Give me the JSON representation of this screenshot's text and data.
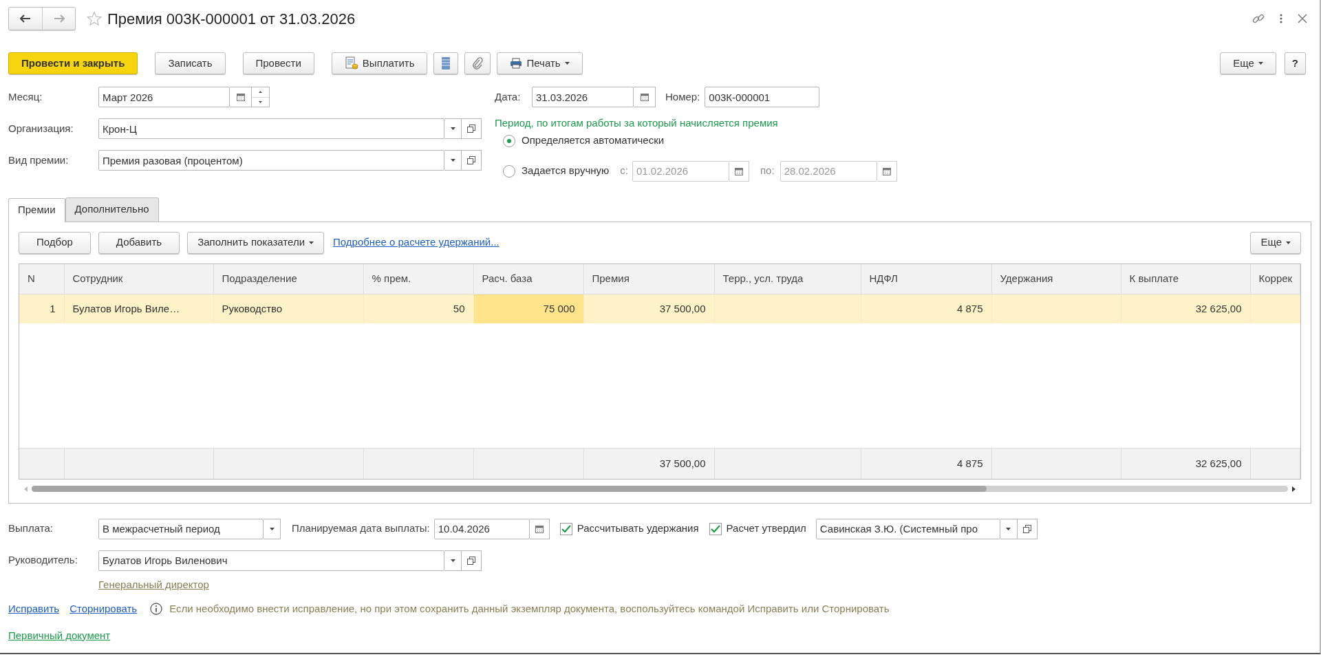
{
  "window": {
    "title": "Премия 003К-000001 от 31.03.2026",
    "favorite": false,
    "nav": [
      {
        "kind": "back",
        "disabled": false
      },
      {
        "kind": "forward",
        "disabled": true
      }
    ]
  },
  "toolbar": [
    {
      "label": "Провести и закрыть",
      "kind": "primary"
    },
    {
      "label": "Записать",
      "kind": "plain"
    },
    {
      "label": "Провести",
      "kind": "plain"
    },
    {
      "label": "Выплатить",
      "kind": "pay"
    },
    {
      "kind": "list"
    },
    {
      "kind": "clip"
    },
    {
      "label": "Печать",
      "kind": "print",
      "dropdown": true
    }
  ],
  "toolbar_right": [
    {
      "label": "Еще",
      "kind": "plain",
      "dropdown": true
    },
    {
      "label": "?",
      "kind": "help"
    }
  ],
  "fields_left": [
    {
      "label": "Месяц:",
      "value": "Март 2026",
      "kind": "month"
    },
    {
      "label": "Организация:",
      "value": "Крон-Ц",
      "kind": "ref"
    },
    {
      "label": "Вид премии:",
      "value": "Премия разовая (процентом)",
      "kind": "ref"
    }
  ],
  "date": {
    "label": "Дата:",
    "value": "31.03.2026"
  },
  "number": {
    "label": "Номер:",
    "value": "003К-000001"
  },
  "period": {
    "heading": "Период, по итогам работы за который начисляется премия",
    "options": [
      {
        "label": "Определяется автоматически",
        "selected": true
      },
      {
        "label": "Задается вручную",
        "selected": false
      }
    ],
    "from": {
      "label": "с:",
      "value": "01.02.2026",
      "disabled": true
    },
    "to": {
      "label": "по:",
      "value": "28.02.2026",
      "disabled": true
    }
  },
  "tabs": [
    {
      "label": "Премии",
      "selected": true
    },
    {
      "label": "Дополнительно",
      "selected": false
    }
  ],
  "table_toolbar": {
    "buttons": [
      {
        "label": "Подбор"
      },
      {
        "label": "Добавить"
      },
      {
        "label": "Заполнить показатели",
        "dropdown": true
      }
    ],
    "link": "Подробнее о расчете удержаний...",
    "more": {
      "label": "Еще",
      "dropdown": true
    }
  },
  "table": {
    "columns": [
      {
        "label": "N",
        "kind": "numeric"
      },
      {
        "label": "Сотрудник",
        "kind": "text"
      },
      {
        "label": "Подразделение",
        "kind": "text"
      },
      {
        "label": "% прем.",
        "kind": "numeric"
      },
      {
        "label": "Расч. база",
        "kind": "numeric"
      },
      {
        "label": "Премия",
        "kind": "numeric",
        "total": "37 500,00"
      },
      {
        "label": "Терр., усл. труда",
        "kind": "text"
      },
      {
        "label": "НДФЛ",
        "kind": "numeric",
        "total": "4 875"
      },
      {
        "label": "Удержания",
        "kind": "numeric"
      },
      {
        "label": "К выплате",
        "kind": "numeric",
        "total": "32 625,00"
      },
      {
        "label": "Коррек",
        "kind": "text"
      }
    ],
    "rows": [
      {
        "selected": true,
        "cells": [
          {
            "text": "1",
            "selected": false
          },
          {
            "text": "Булатов Игорь Виле…",
            "selected": false
          },
          {
            "text": "Руководство",
            "selected": false
          },
          {
            "text": "50",
            "selected": false
          },
          {
            "text": "75 000",
            "selected": true
          },
          {
            "text": "37 500,00",
            "selected": false
          },
          {
            "selected": false
          },
          {
            "text": "4 875",
            "selected": false
          },
          {
            "selected": false
          },
          {
            "text": "32 625,00",
            "selected": false
          },
          {
            "selected": false
          }
        ]
      }
    ],
    "has_totals": true
  },
  "payment": {
    "label": "Выплата:",
    "value": "В межрасчетный период"
  },
  "planned_date": {
    "label": "Планируемая дата выплаты:",
    "value": "10.04.2026"
  },
  "checks": [
    {
      "label": "Рассчитывать удержания",
      "checked": true
    },
    {
      "label": "Расчет утвердил",
      "checked": true
    }
  ],
  "approver": {
    "value": "Савинская З.Ю. (Системный про"
  },
  "manager": {
    "label": "Руководитель:",
    "value": "Булатов Игорь Виленович",
    "position": "Генеральный директор"
  },
  "footer": {
    "links": [
      "Исправить",
      "Сторнировать"
    ],
    "info": "Если необходимо внести исправление, но при этом сохранить данный экземпляр документа, воспользуйтесь командой Исправить или Сторнировать",
    "primary_link": "Первичный документ"
  }
}
